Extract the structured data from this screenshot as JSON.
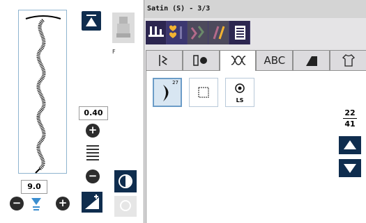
{
  "left_panel": {
    "stitch_width_value": "0.40",
    "stitch_length_value": "9.0",
    "presser_foot_letter": "F",
    "buttons": {
      "width_plus": "+",
      "width_minus": "−",
      "length_minus": "−",
      "length_plus": "+"
    }
  },
  "right_panel": {
    "title": "Satin (S) - 3/3",
    "tabs": [
      {
        "label": "",
        "icon": "utility-stitch-icon"
      },
      {
        "label": "",
        "icon": "buttonhole-icon"
      },
      {
        "label": "",
        "icon": "decorative-stitch-icon",
        "active": true
      },
      {
        "label": "ABC",
        "icon": "alphabet-icon"
      },
      {
        "label": "",
        "icon": "satin-stitch-icon"
      },
      {
        "label": "",
        "icon": "shirt-icon"
      }
    ],
    "stitches": [
      {
        "number": "27",
        "label": "",
        "selected": true
      },
      {
        "number": "",
        "label": ""
      },
      {
        "number": "",
        "label": "LS"
      }
    ],
    "page": {
      "current": "22",
      "total": "41"
    }
  },
  "colors": {
    "navy": "#0f2d4e",
    "toolbar_purple": "#2c2650",
    "panel_grey": "#e5e4e6",
    "selection_blue": "#d8e6f2"
  }
}
